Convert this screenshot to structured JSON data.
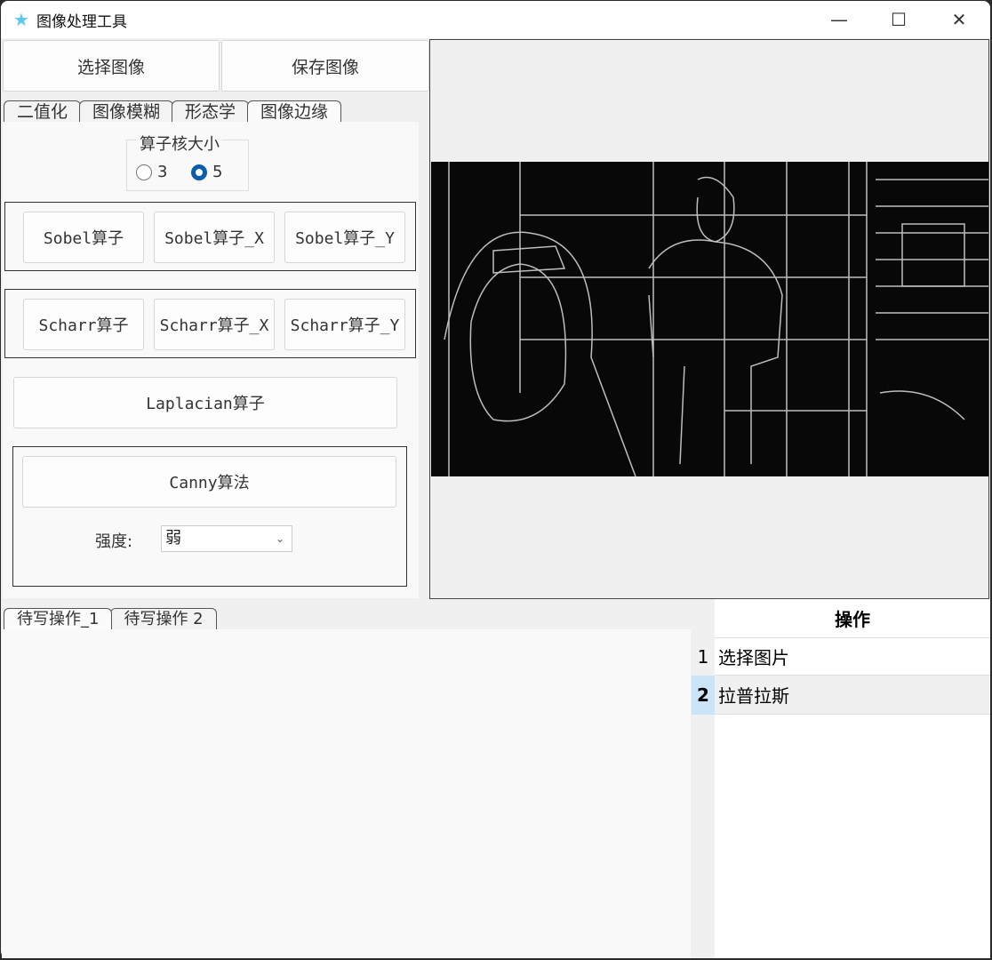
{
  "window": {
    "title": "图像处理工具",
    "icon": "star-icon",
    "minimize": "—",
    "maximize": "☐",
    "close": "✕"
  },
  "toolbar": {
    "select_image": "选择图像",
    "save_image": "保存图像"
  },
  "tabs": [
    "二值化",
    "图像模糊",
    "形态学",
    "图像边缘"
  ],
  "active_tab": 3,
  "kernel": {
    "label": "算子核大小",
    "options": [
      "3",
      "5"
    ],
    "selected": "5"
  },
  "sobel": [
    "Sobel算子",
    "Sobel算子_X",
    "Sobel算子_Y"
  ],
  "scharr": [
    "Scharr算子",
    "Scharr算子_X",
    "Scharr算子_Y"
  ],
  "laplacian": "Laplacian算子",
  "canny": {
    "button": "Canny算法",
    "strength_label": "强度:",
    "strength_value": "弱"
  },
  "bottom_tabs": [
    "待写操作_1",
    "待写操作 2"
  ],
  "history": {
    "header": "操作",
    "rows": [
      {
        "index": "1",
        "op": "选择图片"
      },
      {
        "index": "2",
        "op": "拉普拉斯",
        "selected": true
      }
    ]
  },
  "colors": {
    "accent": "#0a5dac",
    "selected_row_header": "#cce4f7"
  }
}
